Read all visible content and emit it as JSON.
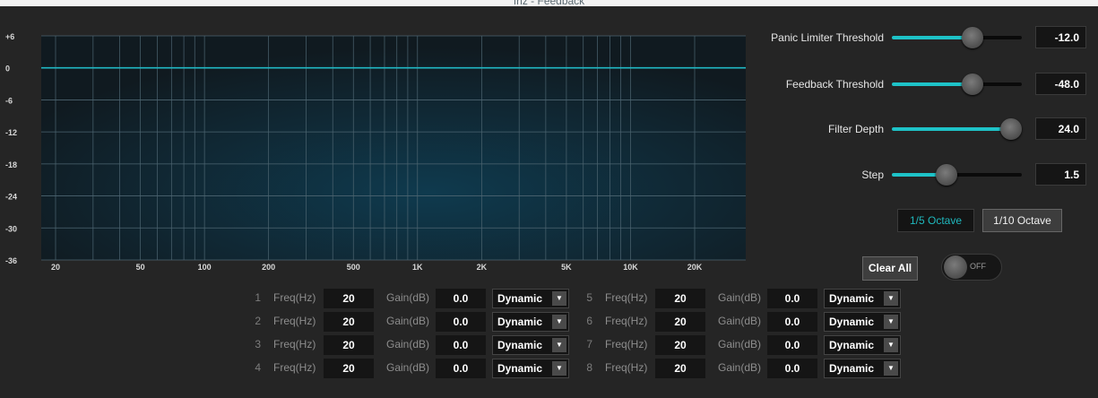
{
  "window": {
    "title": "fhz - Feedback"
  },
  "graph": {
    "y_ticks": [
      "+6",
      "0",
      "-6",
      "-12",
      "-18",
      "-24",
      "-30",
      "-36"
    ],
    "x_ticks": [
      "20",
      "50",
      "100",
      "200",
      "500",
      "1K",
      "2K",
      "5K",
      "10K",
      "20K"
    ],
    "x_min_hz": 20,
    "x_max_hz": 20000,
    "y_min_db": -36,
    "y_max_db": 6,
    "response_db": 0,
    "curve_color": "#20b8c4"
  },
  "controls": {
    "panic_limiter": {
      "label": "Panic Limiter Threshold",
      "value": "-12.0",
      "fraction": 0.62
    },
    "feedback_threshold": {
      "label": "Feedback Threshold",
      "value": "-48.0",
      "fraction": 0.62
    },
    "filter_depth": {
      "label": "Filter Depth",
      "value": "24.0",
      "fraction": 0.92
    },
    "step": {
      "label": "Step",
      "value": "1.5",
      "fraction": 0.42
    },
    "octave": {
      "fifth": "1/5 Octave",
      "tenth": "1/10 Octave",
      "selected": "1/5 Octave"
    },
    "clear_all": "Clear All",
    "toggle": {
      "state": "OFF"
    }
  },
  "filters": [
    {
      "num": "1",
      "freq_label": "Freq(Hz)",
      "freq": "20",
      "gain_label": "Gain(dB)",
      "gain": "0.0",
      "mode": "Dynamic"
    },
    {
      "num": "2",
      "freq_label": "Freq(Hz)",
      "freq": "20",
      "gain_label": "Gain(dB)",
      "gain": "0.0",
      "mode": "Dynamic"
    },
    {
      "num": "3",
      "freq_label": "Freq(Hz)",
      "freq": "20",
      "gain_label": "Gain(dB)",
      "gain": "0.0",
      "mode": "Dynamic"
    },
    {
      "num": "4",
      "freq_label": "Freq(Hz)",
      "freq": "20",
      "gain_label": "Gain(dB)",
      "gain": "0.0",
      "mode": "Dynamic"
    },
    {
      "num": "5",
      "freq_label": "Freq(Hz)",
      "freq": "20",
      "gain_label": "Gain(dB)",
      "gain": "0.0",
      "mode": "Dynamic"
    },
    {
      "num": "6",
      "freq_label": "Freq(Hz)",
      "freq": "20",
      "gain_label": "Gain(dB)",
      "gain": "0.0",
      "mode": "Dynamic"
    },
    {
      "num": "7",
      "freq_label": "Freq(Hz)",
      "freq": "20",
      "gain_label": "Gain(dB)",
      "gain": "0.0",
      "mode": "Dynamic"
    },
    {
      "num": "8",
      "freq_label": "Freq(Hz)",
      "freq": "20",
      "gain_label": "Gain(dB)",
      "gain": "0.0",
      "mode": "Dynamic"
    }
  ],
  "colors": {
    "accent": "#1ec3c8",
    "background": "#252525",
    "plot_bg": "#0f3a4e"
  }
}
